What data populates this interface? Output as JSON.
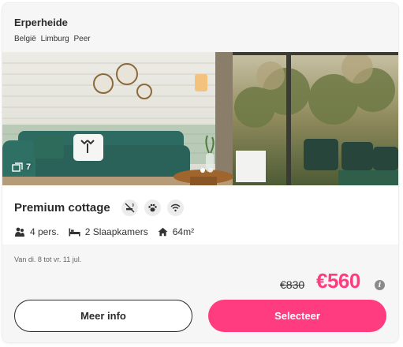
{
  "park": {
    "name": "Erperheide",
    "location": [
      "België",
      "Limburg",
      "Peer"
    ]
  },
  "gallery": {
    "photo_count": "7",
    "dots": 2,
    "active_dot": 0
  },
  "accommodation": {
    "title": "Premium cottage",
    "features": [
      "no-smoking-icon",
      "pets-allowed-icon",
      "wifi-icon"
    ],
    "persons": "4 pers.",
    "bedrooms": "2 Slaapkamers",
    "area": "64m²"
  },
  "pricing": {
    "dates": "Van di. 8 tot vr. 11 jul.",
    "old_price": "€830",
    "new_price": "€560",
    "info_symbol": "i"
  },
  "buttons": {
    "info_label": "Meer info",
    "select_label": "Selecteer"
  },
  "colors": {
    "accent": "#ff3c7f",
    "panel": "#f6f6f6",
    "text": "#2b2b2b"
  }
}
